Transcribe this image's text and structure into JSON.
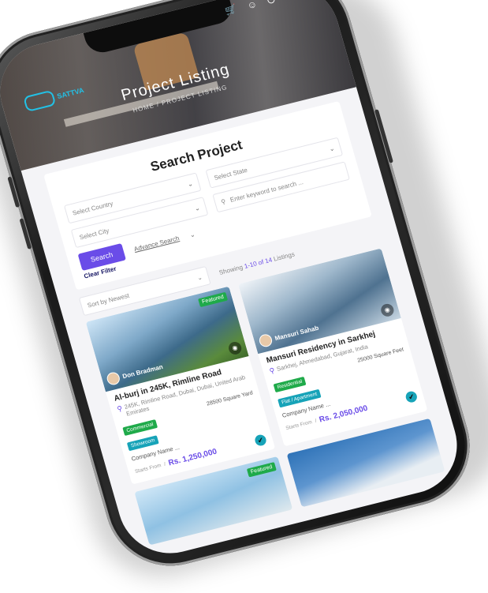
{
  "header": {
    "logo_text": "SATTVA",
    "title": "Project Listing",
    "breadcrumb": "HOME  /  PROJECT LISTING"
  },
  "search": {
    "heading": "Search Project",
    "select_state": "Select State",
    "select_country": "Select Country",
    "keyword_placeholder": "Enter keyword to search ...",
    "select_city": "Select City",
    "search_button": "Search",
    "advance_search": "Advance Search",
    "clear_filter": "Clear Filter"
  },
  "listing": {
    "sort": "Sort by Newest",
    "showing_prefix": "Showing",
    "showing_range": "1-10 of 14",
    "showing_suffix": "Listings"
  },
  "cards": [
    {
      "badge": "Featured",
      "agent": "Don Bradman",
      "title": "Al-burj in 245K, Rimline Road",
      "address": "245K, Rimline Road, Dubai, Dubai, United Arab Emirates",
      "tag1": "Commercial",
      "tag2": "Showroom",
      "area": "28500 Square Yard",
      "company": "Company Name ...",
      "from": "Starts From",
      "price": "Rs. 1,250,000"
    },
    {
      "badge": "",
      "agent": "Mansuri Sahab",
      "title": "Mansuri Residency in Sarkhej",
      "address": "Sarkhej, Ahmedabad, Gujarat, India",
      "tag1": "Residential",
      "tag2": "Flat / Apartment",
      "area": "25000 Square Feet",
      "company": "Company Name ...",
      "from": "Starts From",
      "price": "Rs. 2,050,000"
    },
    {
      "badge": "Featured"
    }
  ],
  "colors": {
    "accent": "#6a4ce8",
    "featured": "#1faa4a",
    "teal": "#17a3b8"
  }
}
